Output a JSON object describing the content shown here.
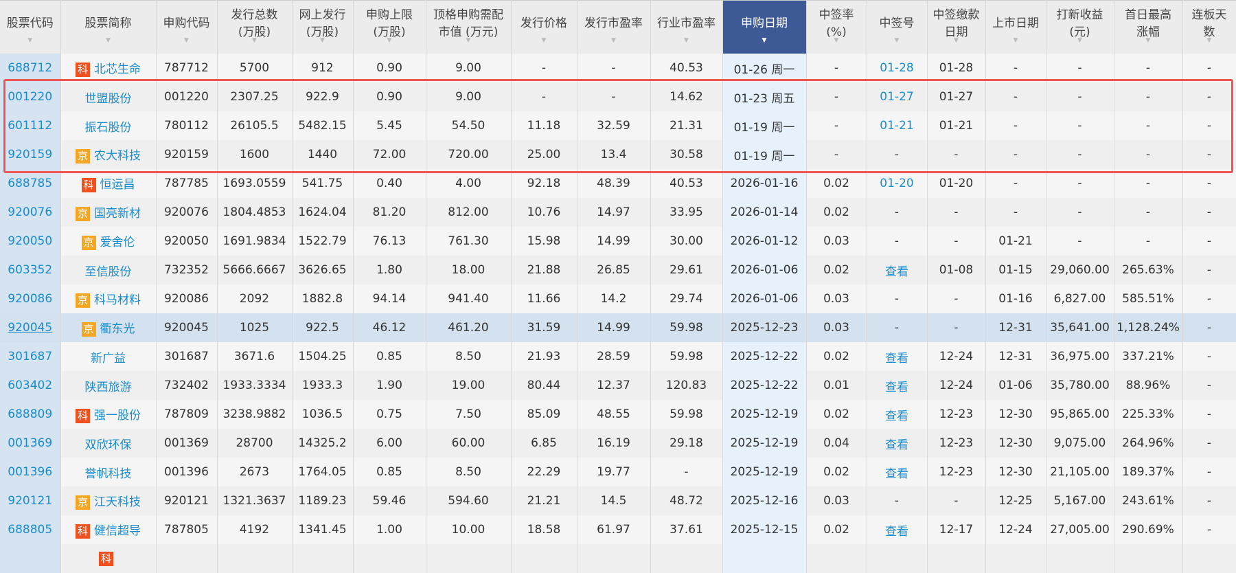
{
  "headers": [
    {
      "l1": "股票代码"
    },
    {
      "l1": "股票简称"
    },
    {
      "l1": "申购代码"
    },
    {
      "l1": "发行总数",
      "l2": "(万股)"
    },
    {
      "l1": "网上发行",
      "l2": "(万股)"
    },
    {
      "l1": "申购上限",
      "l2": "(万股)"
    },
    {
      "l1": "顶格申购需配",
      "l2": "市值 (万元)"
    },
    {
      "l1": "发行价格"
    },
    {
      "l1": "发行市盈率"
    },
    {
      "l1": "行业市盈率"
    },
    {
      "l1": "申购日期",
      "active": true
    },
    {
      "l1": "中签率",
      "l2": "(%)"
    },
    {
      "l1": "中签号"
    },
    {
      "l1": "中签缴款",
      "l2": "日期"
    },
    {
      "l1": "上市日期"
    },
    {
      "l1": "打新收益",
      "l2": "(元)"
    },
    {
      "l1": "首日最高",
      "l2": "涨幅"
    },
    {
      "l1": "连板天",
      "l2": "数"
    }
  ],
  "sort_arrow": "▼",
  "rows": [
    {
      "c": [
        "688712",
        "北芯生命",
        "787712",
        "5700",
        "912",
        "0.90",
        "9.00",
        "-",
        "-",
        "40.53",
        "01-26 周一",
        "-",
        "01-28",
        "01-28",
        "-",
        "-",
        "-",
        "-"
      ],
      "badge": "科"
    },
    {
      "c": [
        "001220",
        "世盟股份",
        "001220",
        "2307.25",
        "922.9",
        "0.90",
        "9.00",
        "-",
        "-",
        "14.62",
        "01-23 周五",
        "-",
        "01-27",
        "01-27",
        "-",
        "-",
        "-",
        "-"
      ]
    },
    {
      "c": [
        "601112",
        "振石股份",
        "780112",
        "26105.5",
        "5482.15",
        "5.45",
        "54.50",
        "11.18",
        "32.59",
        "21.31",
        "01-19 周一",
        "-",
        "01-21",
        "01-21",
        "-",
        "-",
        "-",
        "-"
      ]
    },
    {
      "c": [
        "920159",
        "农大科技",
        "920159",
        "1600",
        "1440",
        "72.00",
        "720.00",
        "25.00",
        "13.4",
        "30.58",
        "01-19 周一",
        "-",
        "-",
        "-",
        "-",
        "-",
        "-",
        "-"
      ],
      "badge": "京"
    },
    {
      "c": [
        "688785",
        "恒运昌",
        "787785",
        "1693.0559",
        "541.75",
        "0.40",
        "4.00",
        "92.18",
        "48.39",
        "40.53",
        "2026-01-16",
        "0.02",
        "01-20",
        "01-20",
        "-",
        "-",
        "-",
        "-"
      ],
      "badge": "科"
    },
    {
      "c": [
        "920076",
        "国亮新材",
        "920076",
        "1804.4853",
        "1624.04",
        "81.20",
        "812.00",
        "10.76",
        "14.97",
        "33.95",
        "2026-01-14",
        "0.02",
        "-",
        "-",
        "-",
        "-",
        "-",
        "-"
      ],
      "badge": "京"
    },
    {
      "c": [
        "920050",
        "爱舍伦",
        "920050",
        "1691.9834",
        "1522.79",
        "76.13",
        "761.30",
        "15.98",
        "14.99",
        "30.00",
        "2026-01-12",
        "0.03",
        "-",
        "-",
        "01-21",
        "-",
        "-",
        "-"
      ],
      "badge": "京"
    },
    {
      "c": [
        "603352",
        "至信股份",
        "732352",
        "5666.6667",
        "3626.65",
        "1.80",
        "18.00",
        "21.88",
        "26.85",
        "29.61",
        "2026-01-06",
        "0.02",
        "查看",
        "01-08",
        "01-15",
        "29,060.00",
        "265.63%",
        "-"
      ]
    },
    {
      "c": [
        "920086",
        "科马材料",
        "920086",
        "2092",
        "1882.8",
        "94.14",
        "941.40",
        "11.66",
        "14.2",
        "29.74",
        "2026-01-06",
        "0.03",
        "-",
        "-",
        "01-16",
        "6,827.00",
        "585.51%",
        "-"
      ],
      "badge": "京"
    },
    {
      "c": [
        "920045",
        "衢东光",
        "920045",
        "1025",
        "922.5",
        "46.12",
        "461.20",
        "31.59",
        "14.99",
        "59.98",
        "2025-12-23",
        "0.03",
        "-",
        "-",
        "12-31",
        "35,641.00",
        "1,128.24%",
        "-"
      ],
      "badge": "京",
      "selected": true
    },
    {
      "c": [
        "301687",
        "新广益",
        "301687",
        "3671.6",
        "1504.25",
        "0.85",
        "8.50",
        "21.93",
        "28.59",
        "59.98",
        "2025-12-22",
        "0.02",
        "查看",
        "12-24",
        "12-31",
        "36,975.00",
        "337.21%",
        "-"
      ]
    },
    {
      "c": [
        "603402",
        "陕西旅游",
        "732402",
        "1933.3334",
        "1933.3",
        "1.90",
        "19.00",
        "80.44",
        "12.37",
        "120.83",
        "2025-12-22",
        "0.01",
        "查看",
        "12-24",
        "01-06",
        "35,780.00",
        "88.96%",
        "-"
      ]
    },
    {
      "c": [
        "688809",
        "强一股份",
        "787809",
        "3238.9882",
        "1036.5",
        "0.75",
        "7.50",
        "85.09",
        "48.55",
        "59.98",
        "2025-12-19",
        "0.02",
        "查看",
        "12-23",
        "12-30",
        "95,865.00",
        "225.33%",
        "-"
      ],
      "badge": "科"
    },
    {
      "c": [
        "001369",
        "双欣环保",
        "001369",
        "28700",
        "14325.2",
        "6.00",
        "60.00",
        "6.85",
        "16.19",
        "29.18",
        "2025-12-19",
        "0.04",
        "查看",
        "12-23",
        "12-30",
        "9,075.00",
        "264.96%",
        "-"
      ]
    },
    {
      "c": [
        "001396",
        "誉帆科技",
        "001396",
        "2673",
        "1764.05",
        "0.85",
        "8.50",
        "22.29",
        "19.77",
        "-",
        "2025-12-19",
        "0.02",
        "查看",
        "12-23",
        "12-30",
        "21,105.00",
        "189.37%",
        "-"
      ]
    },
    {
      "c": [
        "920121",
        "江天科技",
        "920121",
        "1321.3637",
        "1189.23",
        "59.46",
        "594.60",
        "21.21",
        "14.5",
        "48.72",
        "2025-12-16",
        "0.03",
        "-",
        "-",
        "12-25",
        "5,167.00",
        "243.61%",
        "-"
      ],
      "badge": "京"
    },
    {
      "c": [
        "688805",
        "健信超导",
        "787805",
        "4192",
        "1341.45",
        "1.00",
        "10.00",
        "18.58",
        "61.97",
        "37.61",
        "2025-12-15",
        "0.02",
        "查看",
        "12-17",
        "12-24",
        "27,005.00",
        "290.69%",
        "-"
      ],
      "badge": "科"
    },
    {
      "c": [
        "",
        "",
        "",
        "",
        "",
        "",
        "",
        "",
        "",
        "",
        "",
        "",
        "",
        "",
        "",
        "",
        "",
        ""
      ],
      "badge": "科"
    }
  ]
}
